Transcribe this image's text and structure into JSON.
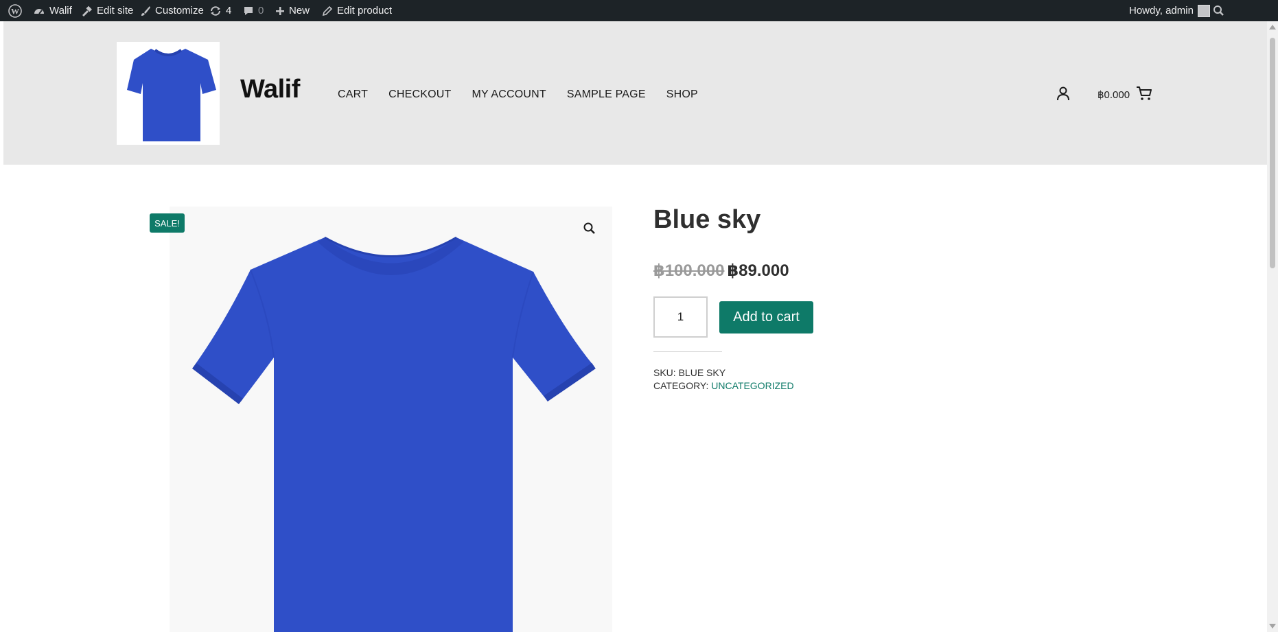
{
  "admin_bar": {
    "site_name": "Walif",
    "edit_site": "Edit site",
    "customize": "Customize",
    "updates_count": "4",
    "comments_count": "0",
    "new_label": "New",
    "edit_product": "Edit product",
    "greeting": "Howdy, admin"
  },
  "header": {
    "site_title": "Walif",
    "nav": [
      "CART",
      "CHECKOUT",
      "MY ACCOUNT",
      "SAMPLE PAGE",
      "SHOP"
    ],
    "cart_total": "฿0.000"
  },
  "product": {
    "sale_badge": "SALE!",
    "title": "Blue sky",
    "price_old": "฿100.000",
    "price_new": "฿89.000",
    "quantity": "1",
    "add_to_cart": "Add to cart",
    "sku_label": "SKU:",
    "sku_value": "BLUE SKY",
    "category_label": "CATEGORY:",
    "category_value": "UNCATEGORIZED"
  },
  "colors": {
    "admin_bar_bg": "#1d2327",
    "header_bg": "#e8e8e8",
    "accent": "#0e7a68",
    "shirt_blue": "#2f4fc8"
  }
}
